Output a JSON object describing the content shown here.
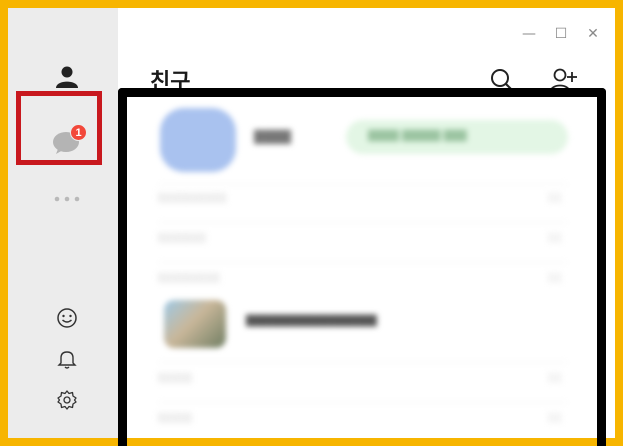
{
  "window": {
    "controls": [
      "—",
      "☐",
      "✕"
    ]
  },
  "sidebar": {
    "items": [
      {
        "name": "friends",
        "icon": "person-icon"
      },
      {
        "name": "chats",
        "icon": "chat-bubble-icon",
        "badge": "1"
      },
      {
        "name": "more",
        "icon": "more-dots-icon"
      }
    ],
    "bottom": [
      {
        "name": "emoticon",
        "icon": "smiley-icon"
      },
      {
        "name": "notifications",
        "icon": "bell-icon"
      },
      {
        "name": "settings",
        "icon": "gear-icon"
      }
    ]
  },
  "header": {
    "title": "친구"
  },
  "colors": {
    "accent_frame": "#f7b500",
    "highlight_box": "#c8181e",
    "badge": "#f2483a",
    "mask_frame": "#000000"
  }
}
